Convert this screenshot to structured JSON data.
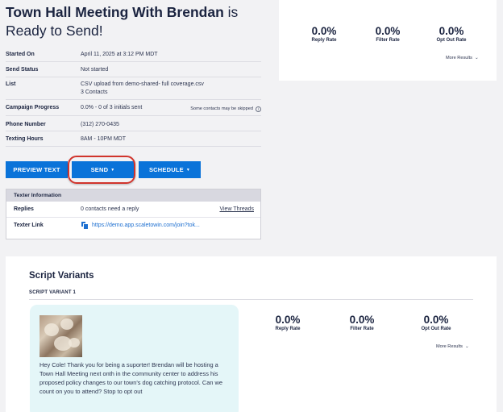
{
  "header": {
    "title_bold": "Town Hall Meeting With Brendan",
    "title_rest": " is Ready to Send!"
  },
  "details": [
    {
      "label": "Started On",
      "value": "April 11, 2025 at 3:12 PM MDT"
    },
    {
      "label": "Send Status",
      "value": "Not started"
    },
    {
      "label": "List",
      "value": "CSV upload from demo-shared- full coverage.csv",
      "value2": "3 Contacts"
    },
    {
      "label": "Campaign Progress",
      "value": "0.0% - 0 of 3 initials sent",
      "note": "Some contacts may be skipped"
    },
    {
      "label": "Phone Number",
      "value": "(312) 270-0435"
    },
    {
      "label": "Texting Hours",
      "value": "8AM - 10PM MDT"
    }
  ],
  "buttons": {
    "preview": "PREVIEW TEXT",
    "send": "SEND",
    "schedule": "SCHEDULE"
  },
  "texter": {
    "header": "Texter Information",
    "replies_label": "Replies",
    "replies_value": "0 contacts need a reply",
    "view_threads": "View Threads",
    "link_label": "Texter Link",
    "link_value": "https://demo.app.scaletowin.com/join?tok..."
  },
  "stats_top": {
    "reply_rate": "0.0%",
    "reply_label": "Reply Rate",
    "filter_rate": "0.0%",
    "filter_label": "Filter Rate",
    "opt_out_rate": "0.0%",
    "opt_out_label": "Opt Out Rate",
    "more": "More Results"
  },
  "script_variants": {
    "title": "Script Variants",
    "variant_label": "SCRIPT VARIANT 1",
    "message": "Hey Cole! Thank you for being a suporter! Brendan will be hosting a Town Hall Meeting next onth in the community center to address his proposed policy changes to our town's dog catching protocol. Can we count on you to attend? Stop to opt out",
    "stats": {
      "reply_rate": "0.0%",
      "reply_label": "Reply Rate",
      "filter_rate": "0.0%",
      "filter_label": "Filter Rate",
      "opt_out_rate": "0.0%",
      "opt_out_label": "Opt Out Rate",
      "more": "More Results"
    }
  },
  "colors": {
    "primary": "#0a73d9",
    "highlight": "#d1342c",
    "bubble": "#e4f6f8"
  },
  "icons": [
    "info-icon",
    "copy-icon",
    "chevron-down-icon"
  ]
}
